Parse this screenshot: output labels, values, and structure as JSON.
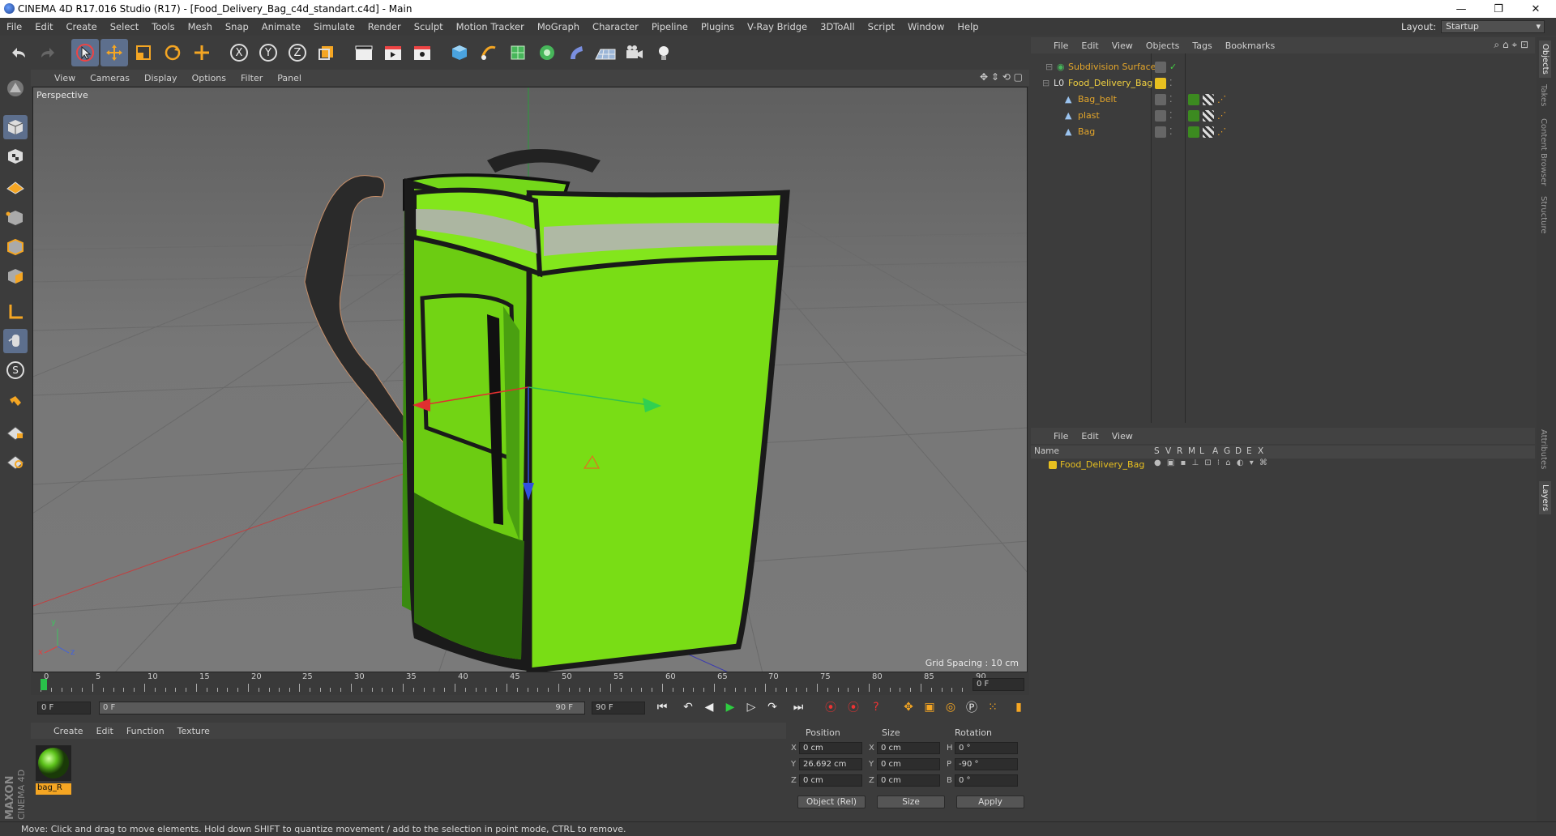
{
  "window": {
    "title": "CINEMA 4D R17.016 Studio (R17) - [Food_Delivery_Bag_c4d_standart.c4d] - Main"
  },
  "menu": [
    "File",
    "Edit",
    "Create",
    "Select",
    "Tools",
    "Mesh",
    "Snap",
    "Animate",
    "Simulate",
    "Render",
    "Sculpt",
    "Motion Tracker",
    "MoGraph",
    "Character",
    "Pipeline",
    "Plugins",
    "V-Ray Bridge",
    "3DToAll",
    "Script",
    "Window",
    "Help"
  ],
  "layout": {
    "label": "Layout:",
    "value": "Startup"
  },
  "toolbar": {
    "axis_x": "X",
    "axis_y": "Y",
    "axis_z": "Z"
  },
  "viewport": {
    "menu": [
      "View",
      "Cameras",
      "Display",
      "Options",
      "Filter",
      "Panel"
    ],
    "name": "Perspective",
    "grid_spacing": "Grid Spacing : 10 cm",
    "axis_x": "x",
    "axis_y": "y",
    "axis_z": "z"
  },
  "timeline": {
    "ticks": [
      "0",
      "5",
      "10",
      "15",
      "20",
      "25",
      "30",
      "35",
      "40",
      "45",
      "50",
      "55",
      "60",
      "65",
      "70",
      "75",
      "80",
      "85",
      "90"
    ],
    "current": "0 F"
  },
  "playback": {
    "start": "0 F",
    "range_start": "0 F",
    "range_end": "90 F",
    "end": "90 F"
  },
  "material": {
    "menu": [
      "Create",
      "Edit",
      "Function",
      "Texture"
    ],
    "items": [
      {
        "name": "bag_R"
      }
    ]
  },
  "coords": {
    "headers": [
      "Position",
      "Size",
      "Rotation"
    ],
    "rows": [
      {
        "axis": "X",
        "pos": "0 cm",
        "saxis": "X",
        "size": "0 cm",
        "raxis": "H",
        "rot": "0 °"
      },
      {
        "axis": "Y",
        "pos": "26.692 cm",
        "saxis": "Y",
        "size": "0 cm",
        "raxis": "P",
        "rot": "-90 °"
      },
      {
        "axis": "Z",
        "pos": "0 cm",
        "saxis": "Z",
        "size": "0 cm",
        "raxis": "B",
        "rot": "0 °"
      }
    ],
    "mode": "Object (Rel)",
    "size_mode": "Size",
    "apply": "Apply"
  },
  "objects": {
    "menu": [
      "File",
      "Edit",
      "View",
      "Objects",
      "Tags",
      "Bookmarks"
    ],
    "tree": [
      {
        "name": "Subdivision Surface",
        "color": "#e3a52a"
      },
      {
        "name": "Food_Delivery_Bag",
        "color": "#f0d040"
      },
      {
        "name": "Bag_belt",
        "color": "#e3a52a"
      },
      {
        "name": "plast",
        "color": "#e3a52a"
      },
      {
        "name": "Bag",
        "color": "#e3a52a"
      }
    ]
  },
  "layers": {
    "menu": [
      "File",
      "Edit",
      "View"
    ],
    "columns": [
      "Name",
      "S",
      "V",
      "R",
      "M",
      "L",
      "A",
      "G",
      "D",
      "E",
      "X"
    ],
    "rows": [
      {
        "name": "Food_Delivery_Bag",
        "color": "#e8c020"
      }
    ]
  },
  "sidetabs": [
    "Objects",
    "Takes",
    "Content Browser",
    "Structure",
    "Attributes",
    "Layers"
  ],
  "status": "Move: Click and drag to move elements. Hold down SHIFT to quantize movement / add to the selection in point mode, CTRL to remove.",
  "brand": {
    "maxon": "MAXON",
    "cinema": "CINEMA 4D"
  }
}
